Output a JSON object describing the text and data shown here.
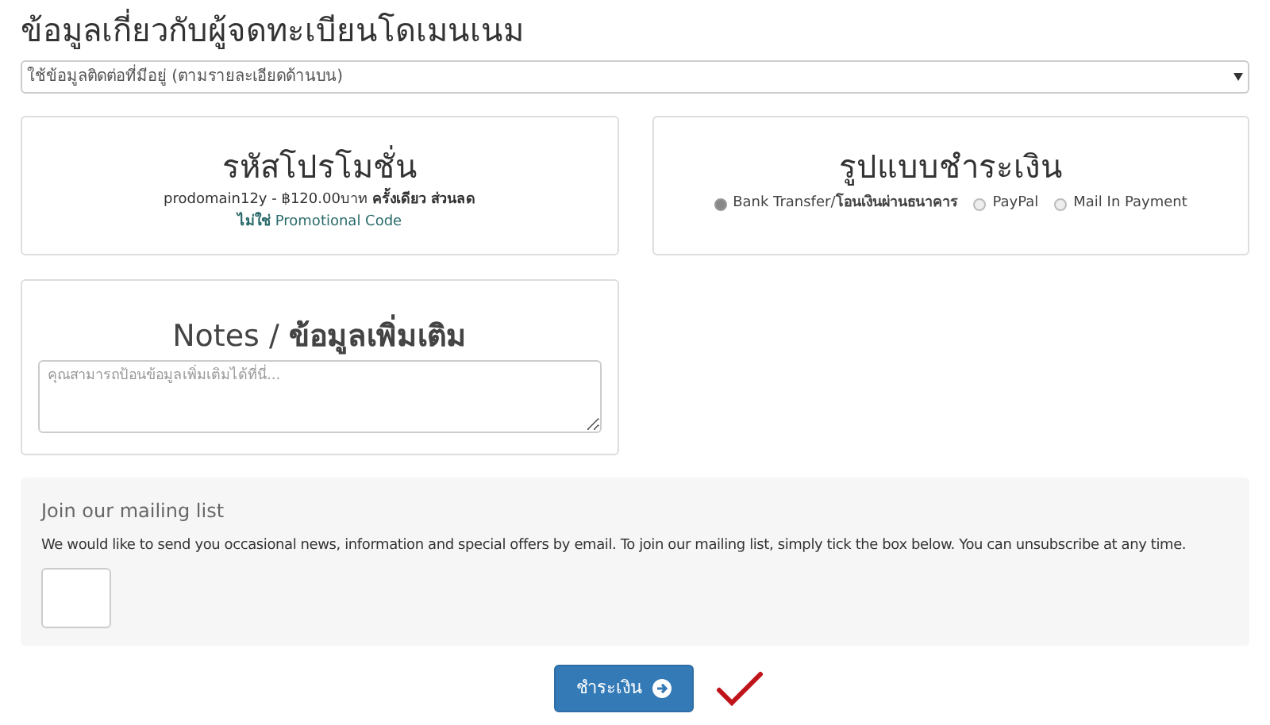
{
  "heading": "ข้อมูลเกี่ยวกับผู้จดทะเบียนโดเมนเนม",
  "contact_select": {
    "value": "ใช้ข้อมูลติดต่อที่มีอยู่ (ตามรายละเอียดด้านบน)"
  },
  "promo": {
    "title": "รหัสโปรโมชั่น",
    "line": "prodomain12y - ฿120.00บาท **ครั้งเดียว ส่วนลด**",
    "link_prefix": "ไม่ใช่",
    "link": "Promotional Code"
  },
  "payment": {
    "title": "รูปแบบชำระเงิน",
    "options": [
      {
        "label": "Bank Transfer/**โอนเงินผ่านธนาคาร**",
        "selected": true
      },
      {
        "label": "PayPal",
        "selected": false
      },
      {
        "label": "Mail In Payment",
        "selected": false
      }
    ]
  },
  "notes": {
    "title": "Notes / **ข้อมูลเพิ่มเติม**",
    "placeholder": "คุณสามารถป้อนข้อมูลเพิ่มเติมได้ที่นี่..."
  },
  "mailing": {
    "title": "Join our mailing list",
    "text": "We would like to send you occasional news, information and special offers by email. To join our mailing list, simply tick the box below. You can unsubscribe at any time.",
    "checked": false
  },
  "submit": {
    "label": "ชำระเงิน"
  }
}
